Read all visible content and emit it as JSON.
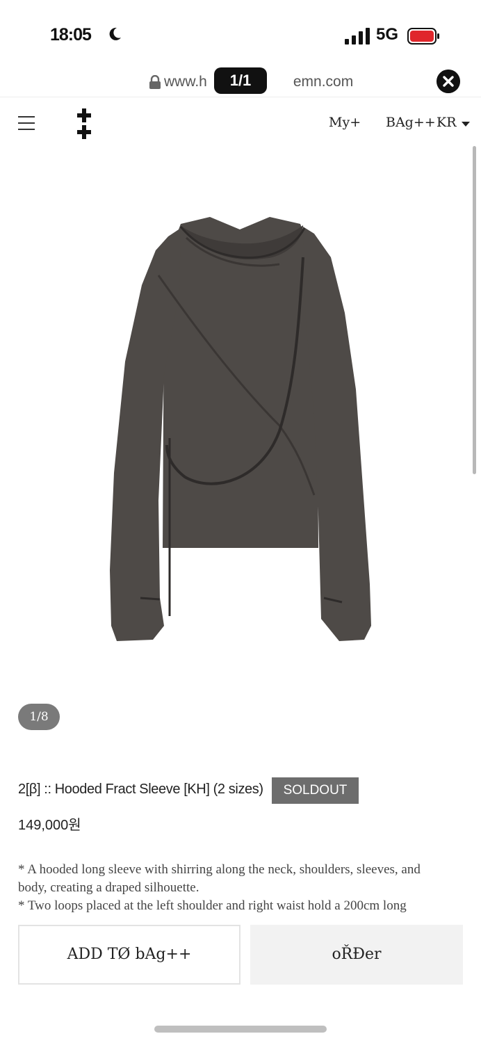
{
  "status_bar": {
    "time": "18:05",
    "network": "5G",
    "icons": [
      "moon-icon",
      "signal-icon",
      "battery-icon"
    ]
  },
  "browser": {
    "url_prefix": "www.h",
    "url_suffix": "emn.com",
    "pager": "1/1",
    "icons": [
      "lock-icon",
      "close-icon"
    ]
  },
  "nav": {
    "my": "My+",
    "bag": "BAg++",
    "lang": "KR",
    "icons": [
      "hamburger-menu-icon",
      "logo-icon",
      "caret-down-icon"
    ]
  },
  "gallery": {
    "counter": "1/8"
  },
  "product": {
    "title": "2[β] :: Hooded Fract Sleeve [KH] (2 sizes)",
    "badge": "SOLDOUT",
    "price": "149,000원",
    "color": "#4e4a47",
    "description": [
      "* A hooded long sleeve with shirring along the neck, shoulders, sleeves, and",
      "body, creating a draped silhouette.",
      "* Two loops placed at the left shoulder and right waist hold a 200cm long"
    ]
  },
  "actions": {
    "add_to_bag": "ADD TØ bAg++",
    "order": "oŘĐer"
  }
}
